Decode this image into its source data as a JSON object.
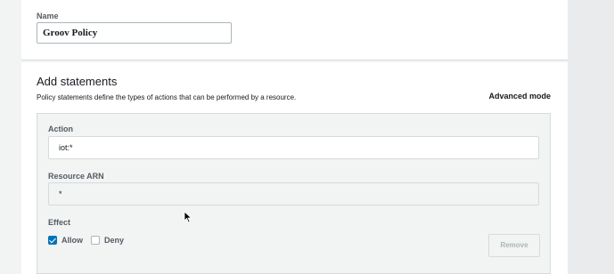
{
  "name_section": {
    "label": "Name",
    "value": "Groov Policy"
  },
  "statements": {
    "title": "Add statements",
    "description": "Policy statements define the types of actions that can be performed by a resource.",
    "advanced_mode": "Advanced mode",
    "action": {
      "label": "Action",
      "value": "iot:*"
    },
    "resource": {
      "label": "Resource ARN",
      "value": "*"
    },
    "effect": {
      "label": "Effect",
      "options": [
        {
          "label": "Allow",
          "checked": true
        },
        {
          "label": "Deny",
          "checked": false
        }
      ]
    },
    "remove_label": "Remove"
  },
  "colors": {
    "accent": "#0073bb",
    "page_bg": "#f2f3f3"
  },
  "icons": [
    "checkbox-checked-icon",
    "checkbox-unchecked-icon",
    "mouse-pointer-icon"
  ]
}
